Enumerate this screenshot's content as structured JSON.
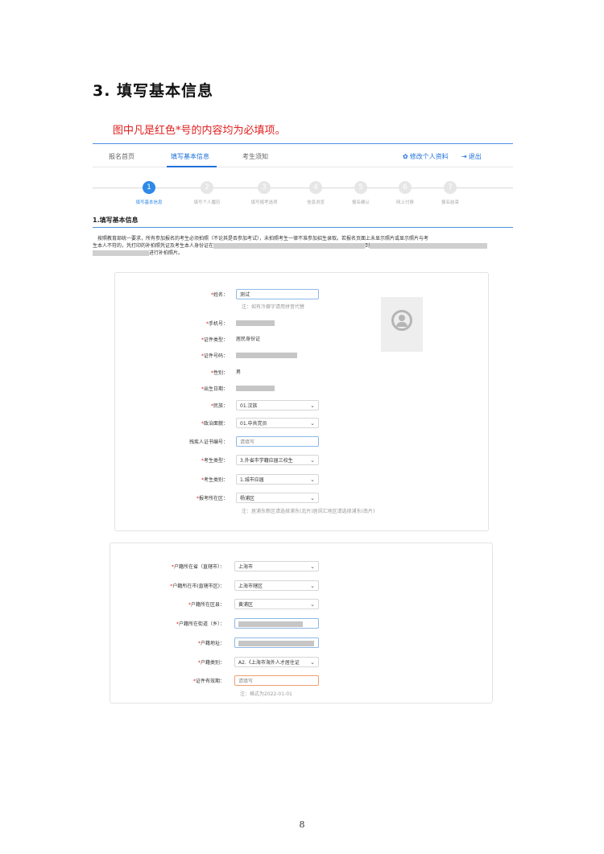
{
  "doc": {
    "heading": "3. 填写基本信息",
    "note": "图中凡是红色*号的内容均为必填项。",
    "page_number": "8"
  },
  "topbar": {
    "tabs": [
      {
        "label": "报名首页"
      },
      {
        "label": "填写基本信息"
      },
      {
        "label": "考生须知"
      }
    ],
    "edit_profile": "修改个人资料",
    "logout": "退出",
    "edit_icon": "gear-icon",
    "logout_icon": "logout-icon"
  },
  "steps": [
    {
      "num": "1",
      "label": "填写基本信息"
    },
    {
      "num": "2",
      "label": "填写个人履历"
    },
    {
      "num": "3",
      "label": "填写报考选项"
    },
    {
      "num": "4",
      "label": "信息浏览"
    },
    {
      "num": "5",
      "label": "报名确认"
    },
    {
      "num": "6",
      "label": "网上付费"
    },
    {
      "num": "7",
      "label": "报名结束"
    }
  ],
  "section_title": "1.填写基本信息",
  "notice": {
    "line1": "按照教育部统一要求，所有参加报名的考生必须拍照（不论其是否参加考试），未拍照考生一律不准参加招生录取。若报名页面上未显示照片或显示照片与考",
    "line2a": "生本人不符的，凭打印的补拍照凭证及考生本人身份证在",
    "line2b": "到",
    "line3": "进行补拍照片。"
  },
  "card1": {
    "name_label": "姓名：",
    "name_value": "测试",
    "name_hint": "注：如有冷僻字请用拼音代替",
    "phone_label": "手机号：",
    "idtype_label": "证件类型：",
    "idtype_value": "居民身份证",
    "idno_label": "证件号码：",
    "gender_label": "性别：",
    "gender_value": "男",
    "birth_label": "出生日期：",
    "ethnic_label": "民族：",
    "ethnic_value": "01.汉族",
    "political_label": "政治面貌：",
    "political_value": "01.中共党员",
    "disability_label": "残疾人证书编号：",
    "disability_placeholder": "请填写",
    "examtype_label": "考生类型：",
    "examtype_value": "3.外省市学籍应届三校生",
    "category_label": "考生类别：",
    "category_value": "1.城市应届",
    "district_label": "报考所在区：",
    "district_value": "杨浦区",
    "district_hint": "注：居浦东新区请选择浦东(北片)居闵汇地区请选择浦东(南片)"
  },
  "card2": {
    "province_label": "户籍所在省（直辖市）：",
    "province_value": "上海市",
    "city_label": "户籍所在市(直辖市区)：",
    "city_value": "上海市辖区",
    "county_label": "户籍所在区县：",
    "county_value": "黄浦区",
    "street_label": "户籍所在街道（乡）：",
    "address_label": "户籍地址：",
    "hukoutype_label": "户籍类别：",
    "hukoutype_value": "A2.《上海市海外人才居住证",
    "validity_label": "证件有效期：",
    "validity_placeholder": "请填写",
    "validity_hint": "注：格式为2022-01-01"
  },
  "colors": {
    "accent": "#1e6fd9",
    "required": "#e02020",
    "step_active": "#2e8ae6"
  }
}
